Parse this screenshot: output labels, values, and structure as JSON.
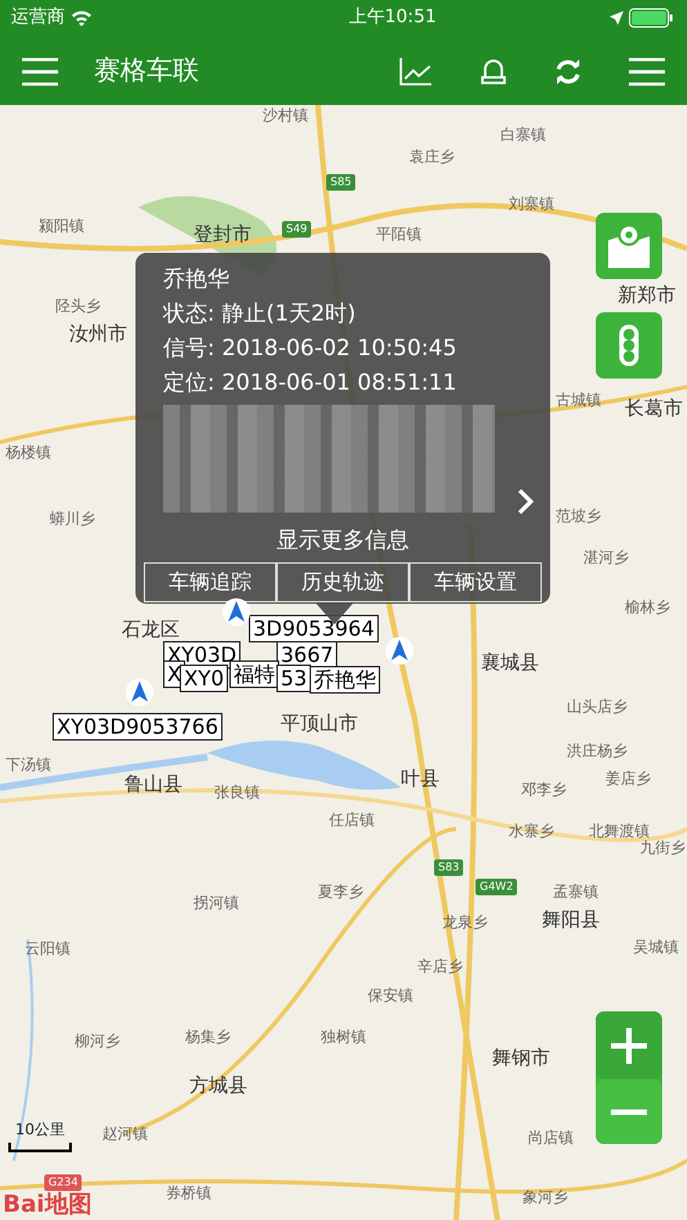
{
  "status_bar": {
    "carrier": "运营商",
    "time": "上午10:51"
  },
  "navbar": {
    "title": "赛格车联"
  },
  "map": {
    "places": [
      "沙村镇",
      "白寨镇",
      "袁庄乡",
      "刘寨镇",
      "颍阳镇",
      "登封市",
      "平陌镇",
      "新郑市",
      "陉头乡",
      "汝州市",
      "杨楼镇",
      "蟒川乡",
      "长葛市",
      "古城镇",
      "范坡乡",
      "湛河乡",
      "榆林乡",
      "石龙区",
      "襄城县",
      "山头店乡",
      "洪庄杨乡",
      "姜店乡",
      "下汤镇",
      "鲁山县",
      "平顶山市",
      "张良镇",
      "邓李乡",
      "任店镇",
      "叶县",
      "水寨乡",
      "北舞渡镇",
      "九街乡",
      "夏李乡",
      "孟寨镇",
      "龙泉乡",
      "拐河镇",
      "云阳镇",
      "辛店乡",
      "舞阳县",
      "吴城镇",
      "保安镇",
      "柳河乡",
      "杨集乡",
      "独树镇",
      "舞钢市",
      "方城县",
      "尚店镇",
      "赵河镇",
      "象河乡",
      "券桥镇"
    ],
    "shields": [
      "S85",
      "S49",
      "S83",
      "G4W2",
      "G234"
    ],
    "scale": "10公里",
    "logo": "Bai地图",
    "vehicle_labels": [
      "3D9053964",
      "XY03D",
      "3667",
      "X",
      "XY0",
      "福特",
      "53",
      "乔艳华",
      "XY03D9053766"
    ]
  },
  "popup": {
    "name": "乔艳华",
    "lines": [
      {
        "label": "状态:",
        "value": "静止(1天2时)"
      },
      {
        "label": "信号:",
        "value": "2018-06-02 10:50:45"
      },
      {
        "label": "定位:",
        "value": "2018-06-01 08:51:11"
      }
    ],
    "more": "显示更多信息",
    "buttons": [
      "车辆追踪",
      "历史轨迹",
      "车辆设置"
    ]
  }
}
